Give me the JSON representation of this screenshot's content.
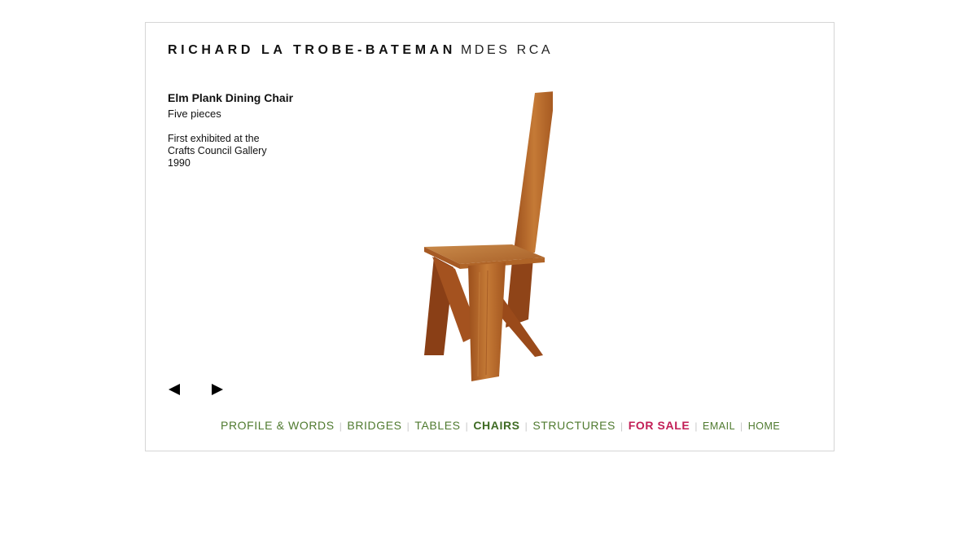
{
  "header": {
    "name": "RICHARD LA TROBE-BATEMAN",
    "credentials": "MDES RCA"
  },
  "piece": {
    "title": "Elm Plank Dining Chair",
    "subtitle": "Five pieces",
    "exhibited_line1": "First exhibited at the",
    "exhibited_line2": "Crafts Council Gallery",
    "year": "1990"
  },
  "gallery": {
    "prev_icon": "triangle-left-icon",
    "next_icon": "triangle-right-icon",
    "image": "elm-plank-dining-chair-photo"
  },
  "nav": {
    "profile": "PROFILE & WORDS",
    "bridges": "BRIDGES",
    "tables": "TABLES",
    "chairs": "CHAIRS",
    "structures": "STRUCTURES",
    "for_sale": "FOR SALE",
    "email": "EMAIL",
    "home": "HOME",
    "separator": "|"
  },
  "colors": {
    "nav_green": "#4f7a2f",
    "for_sale_red": "#c21e56",
    "wood": "#b86a2c",
    "frame_border": "#d6d6d6"
  }
}
